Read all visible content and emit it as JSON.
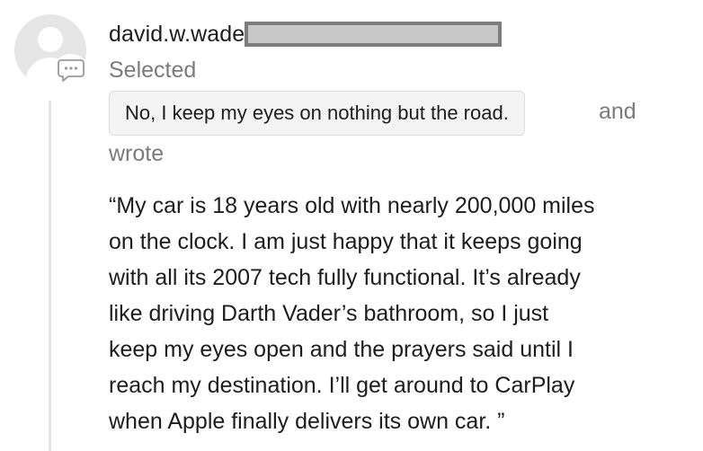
{
  "comment": {
    "author": "david.w.wade",
    "author_redacted": true,
    "selected_label": "Selected",
    "answer": "No, I keep my eyes on nothing but the road.",
    "and_label": "and",
    "wrote_label": "wrote",
    "quote_lines": [
      "“My car is 18 years old with nearly 200,000 miles",
      "on the clock. I am just happy that it keeps going",
      "with all its 2007 tech fully functional. It’s already",
      "like driving Darth Vader’s bathroom, so I just",
      "keep my eyes open and the prayers said until I",
      "reach my destination. I’ll get around to CarPlay",
      "when Apple finally delivers its own car. ”"
    ]
  },
  "icons": {
    "avatar": "default-user-avatar",
    "badge": "comment-bubble-icon"
  },
  "colors": {
    "text_primary": "#1d1d1f",
    "text_secondary": "#7b7b7b",
    "pill_background": "#f4f4f5",
    "pill_border": "#dddddd",
    "avatar_background": "#e6e6e6",
    "thread_line": "#e3e3e3",
    "redaction_fill": "#c8c8c8",
    "redaction_border": "#7d7d7d"
  }
}
